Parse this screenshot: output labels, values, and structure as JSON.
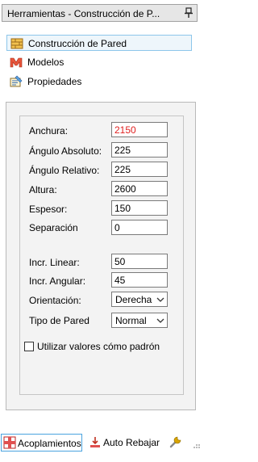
{
  "panel": {
    "title": "Herramientas - Construcción de P...",
    "pin_icon": "pin-icon"
  },
  "nav": [
    {
      "label": "Construcción de Pared",
      "icon": "wall-icon",
      "selected": true
    },
    {
      "label": "Modelos",
      "icon": "models-icon",
      "selected": false
    },
    {
      "label": "Propiedades",
      "icon": "properties-icon",
      "selected": false
    }
  ],
  "form": {
    "anchura": {
      "label": "Anchura:",
      "value": "2150",
      "color": "#e02020"
    },
    "angulo_absoluto": {
      "label": "Ángulo Absoluto:",
      "value": "225"
    },
    "angulo_relativo": {
      "label": "Ángulo Relativo:",
      "value": "225"
    },
    "altura": {
      "label": "Altura:",
      "value": "2600"
    },
    "espesor": {
      "label": "Espesor:",
      "value": "150"
    },
    "separacion": {
      "label": "Separación",
      "value": "0"
    },
    "incr_linear": {
      "label": "Incr. Linear:",
      "value": "50"
    },
    "incr_angular": {
      "label": "Incr. Angular:",
      "value": "45"
    },
    "orientacion": {
      "label": "Orientación:",
      "value": "Derecha"
    },
    "tipo_pared": {
      "label": "Tipo de Pared",
      "value": "Normal"
    },
    "default_checkbox": {
      "label": "Utilizar valores cómo padrón",
      "checked": false
    }
  },
  "tabs": [
    {
      "label": "Acoplamientos",
      "icon": "docking-icon",
      "active": true
    },
    {
      "label": "Auto Rebajar",
      "icon": "auto-lower-icon",
      "active": false
    },
    {
      "label": "",
      "icon": "wrench-icon",
      "active": false
    }
  ]
}
